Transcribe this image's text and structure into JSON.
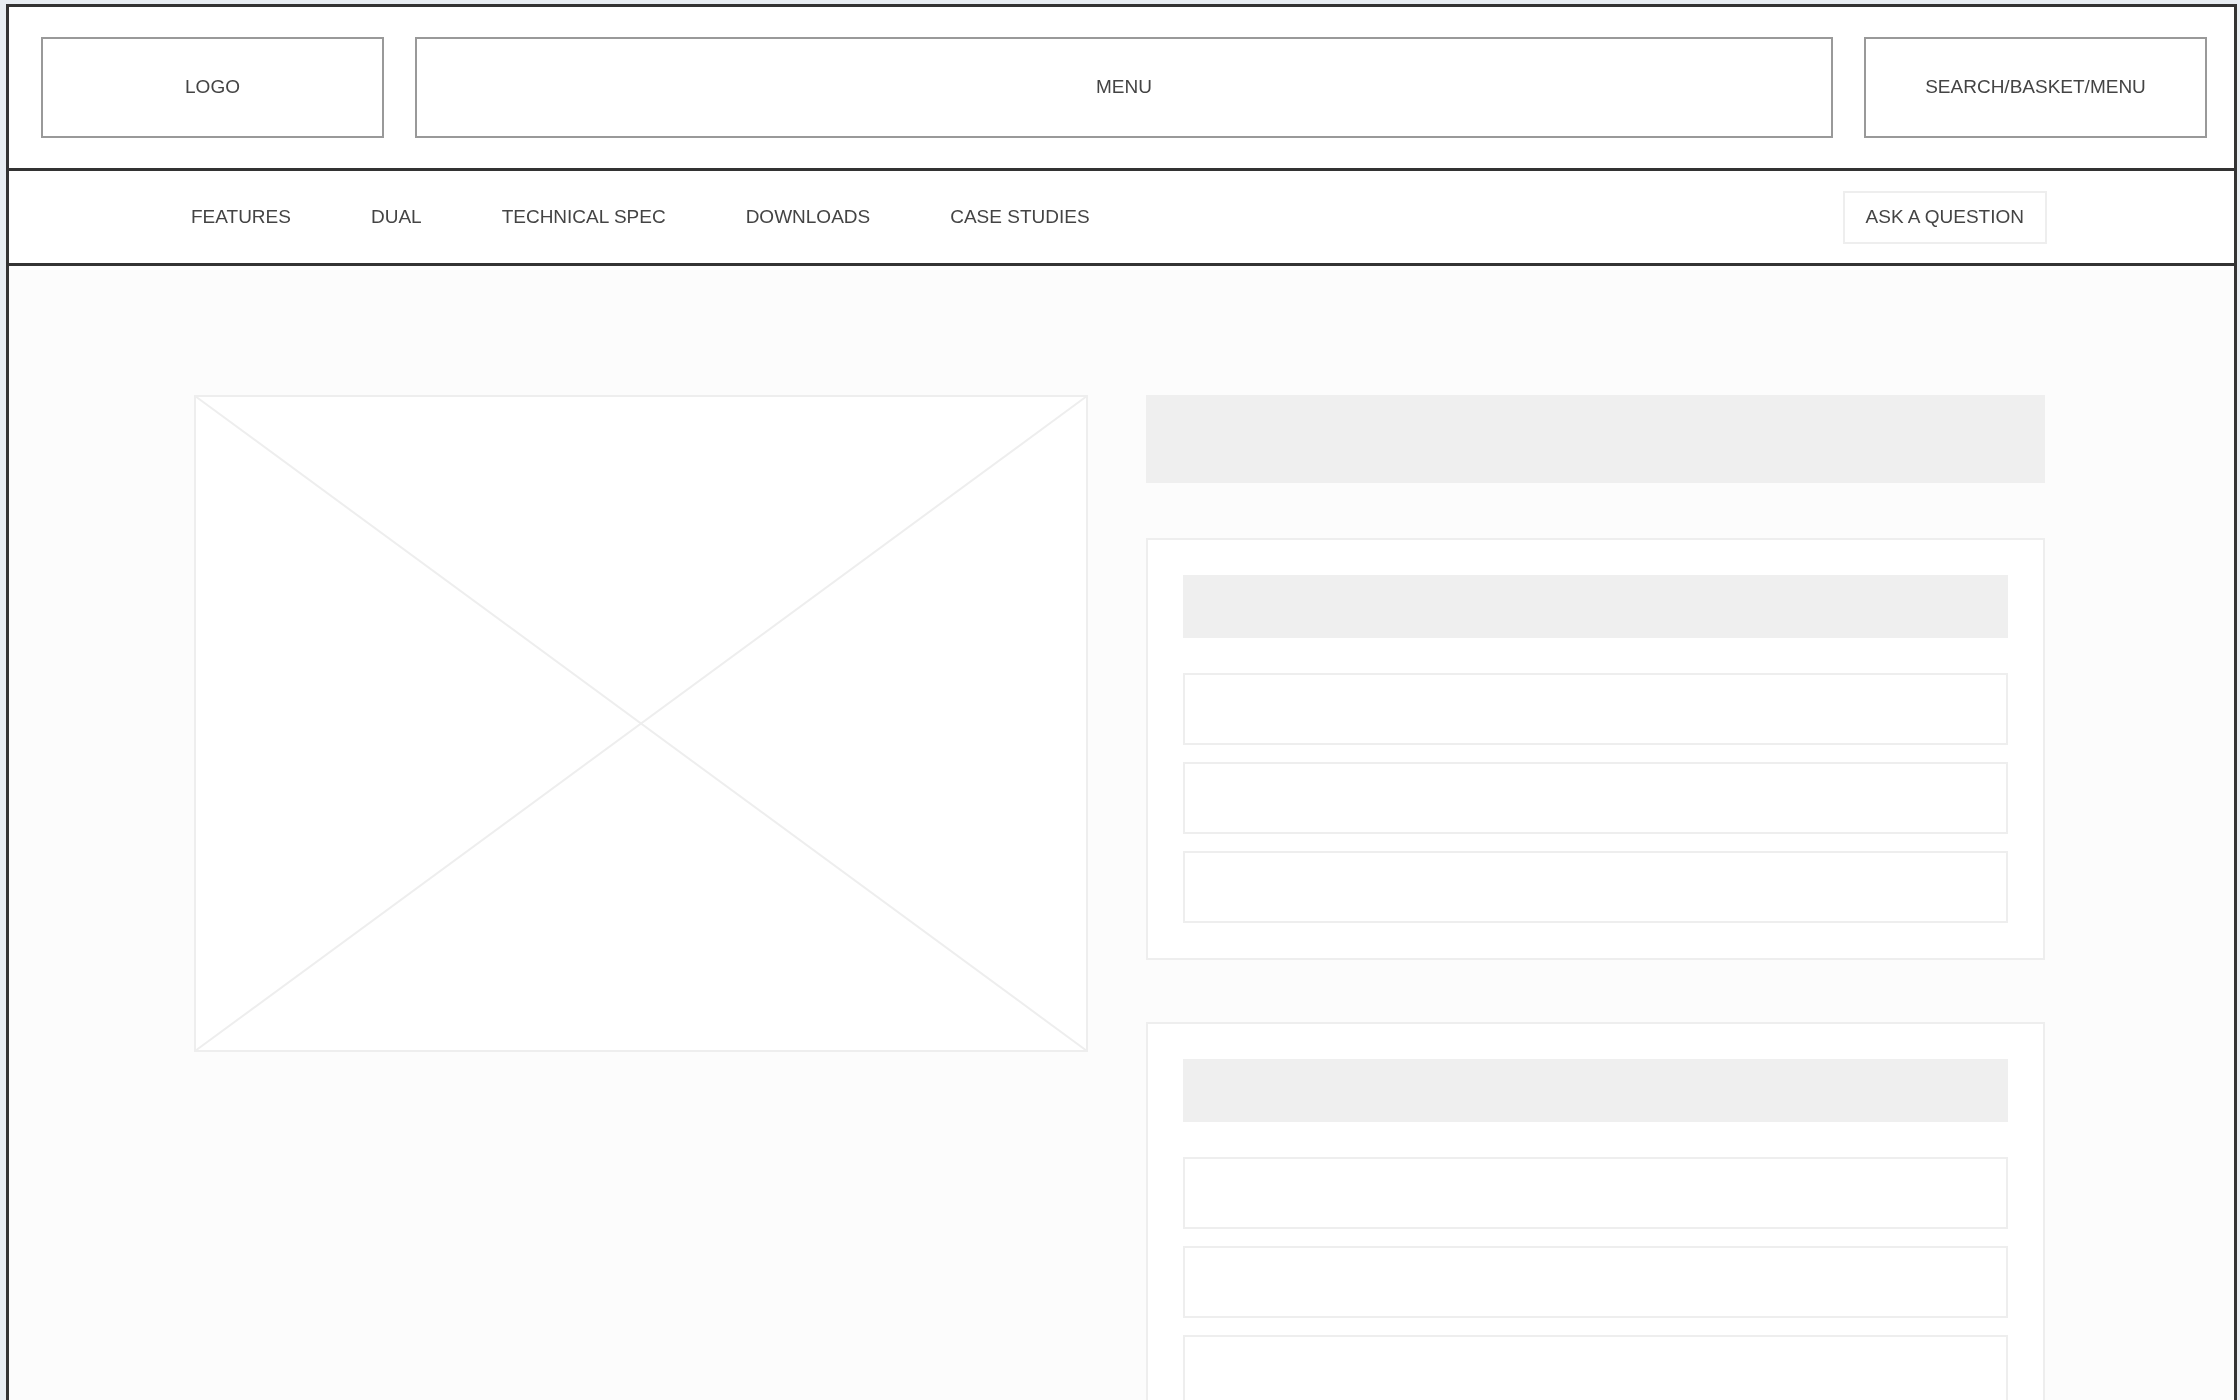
{
  "header": {
    "logo": "LOGO",
    "menu": "MENU",
    "tools": "SEARCH/BASKET/MENU"
  },
  "subnav": {
    "items": [
      "FEATURES",
      "DUAL",
      "TECHNICAL SPEC",
      "DOWNLOADS",
      "CASE STUDIES"
    ],
    "button": "ASK A QUESTION"
  },
  "content": {
    "image": {
      "kind": "placeholder"
    },
    "title_bar": {
      "kind": "placeholder"
    },
    "cards": [
      {
        "fields": [
          {
            "kind": "field"
          },
          {
            "kind": "field"
          },
          {
            "kind": "field"
          }
        ]
      },
      {
        "fields": [
          {
            "kind": "field"
          },
          {
            "kind": "field"
          },
          {
            "kind": "field"
          }
        ]
      }
    ]
  }
}
